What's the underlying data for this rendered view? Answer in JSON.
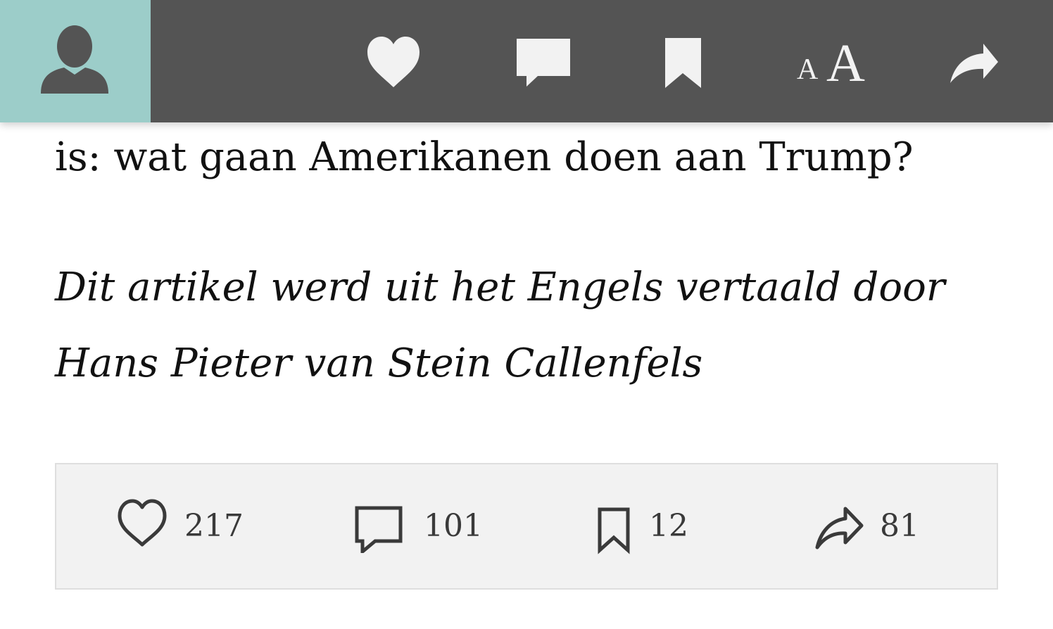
{
  "toolbar": {
    "profile_icon": "user-silhouette-icon",
    "like_icon": "heart-icon",
    "comment_icon": "speech-bubble-icon",
    "bookmark_icon": "bookmark-icon",
    "font_size": {
      "small": "A",
      "large": "A"
    },
    "share_icon": "share-arrow-icon",
    "colors": {
      "bar": "#545454",
      "profile_bg": "#9ccdc9",
      "icon": "#f2f2f2"
    }
  },
  "article": {
    "last_line": "is: wat gaan Amerikanen doen aan Trump?",
    "translation_credit_line1": "Dit artikel werd uit het Engels vertaald door",
    "translation_credit_line2": "Hans Pieter van Stein Callenfels"
  },
  "stats": {
    "likes": "217",
    "comments": "101",
    "bookmarks": "12",
    "shares": "81"
  }
}
